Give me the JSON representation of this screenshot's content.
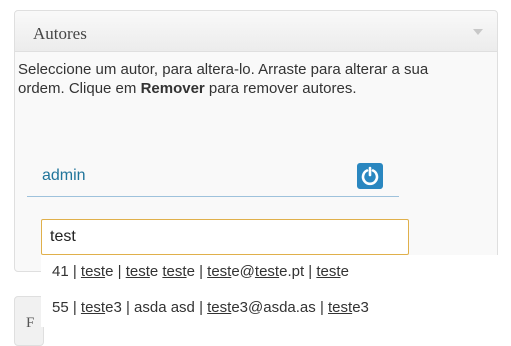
{
  "panel": {
    "title": "Autores",
    "description_before": "Seleccione um autor, para altera-lo. Arraste para alterar a sua ordem. Clique em ",
    "description_bold": "Remover",
    "description_after": " para remover autores."
  },
  "author": {
    "name": "admin",
    "remove_icon": "power-icon"
  },
  "search": {
    "value": "test"
  },
  "suggestions": [
    {
      "id": "41",
      "segments": [
        [
          "41 | ",
          false
        ],
        [
          "test",
          true
        ],
        [
          "e | ",
          false
        ],
        [
          "test",
          true
        ],
        [
          "e ",
          false
        ],
        [
          "test",
          true
        ],
        [
          "e | ",
          false
        ],
        [
          "test",
          true
        ],
        [
          "e@",
          false
        ],
        [
          "test",
          true
        ],
        [
          "e.pt | ",
          false
        ],
        [
          "test",
          true
        ],
        [
          "e",
          false
        ]
      ]
    },
    {
      "id": "55",
      "segments": [
        [
          "55 | ",
          false
        ],
        [
          "test",
          true
        ],
        [
          "e3 | asda asd | ",
          false
        ],
        [
          "test",
          true
        ],
        [
          "e3@asda.as | ",
          false
        ],
        [
          "test",
          true
        ],
        [
          "e3",
          false
        ]
      ]
    }
  ],
  "side_box": {
    "letter": "F"
  },
  "colors": {
    "accent": "#2a87c0",
    "link": "#21759b",
    "input_focus_border": "#e0b04b"
  }
}
